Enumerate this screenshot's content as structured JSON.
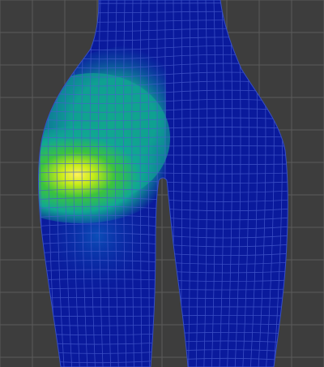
{
  "viewport": {
    "background_color": "#3d3d3d",
    "grid_line_color": "#5a5a5a",
    "mode": "weight-paint"
  },
  "mesh": {
    "base_color": "#0a1a9c",
    "wire_color": "#4a5fd0",
    "weight_gradient": [
      "#0a1a9c",
      "#0b5fb0",
      "#10a892",
      "#3cc43c",
      "#c8ec18",
      "#fff25a"
    ]
  }
}
